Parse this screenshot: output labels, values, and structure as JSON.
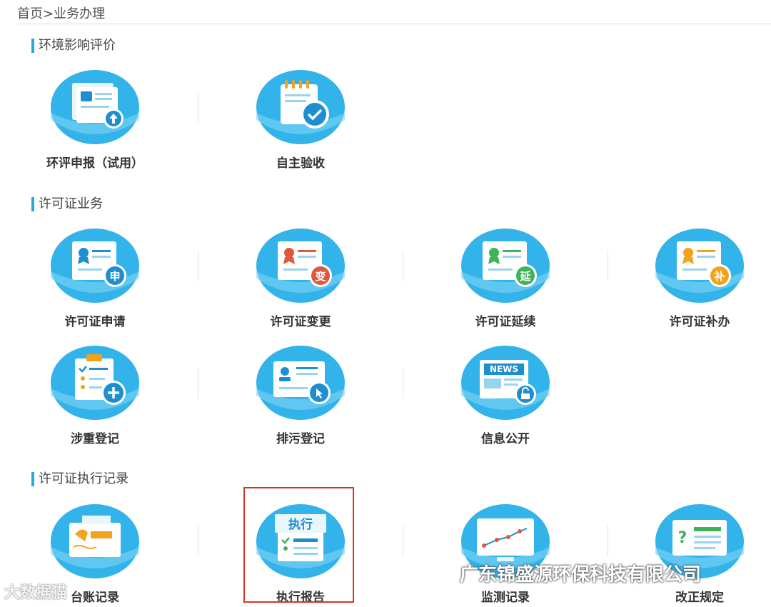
{
  "breadcrumb": "首页>业务办理",
  "sections": {
    "eia": "环境影响评价",
    "permit": "许可证业务",
    "records": "许可证执行记录"
  },
  "tiles": {
    "eia_report": "环评申报（试用）",
    "self_acceptance": "自主验收",
    "permit_apply": "许可证申请",
    "permit_change": "许可证变更",
    "permit_extend": "许可证延续",
    "permit_supplement": "许可证补办",
    "heavy_register": "涉重登记",
    "pollution_register": "排污登记",
    "info_disclosure": "信息公开",
    "ledger_record": "台账记录",
    "exec_report": "执行报告",
    "monitor_record": "监测记录",
    "rectify_rule": "改正规定"
  },
  "badges": {
    "apply": "申",
    "change": "变",
    "extend": "延",
    "supplement": "补",
    "news": "NEWS",
    "exec": "执行"
  },
  "watermark": {
    "left": "大数据猫",
    "right": "广东锦盛源环保科技有限公司"
  },
  "colors": {
    "accent": "#2aa5db",
    "highlight_border": "#d9342b",
    "badge_blue": "#1d8fd0",
    "badge_red": "#e0583b",
    "badge_green": "#3fb35a",
    "badge_orange": "#f2a31c"
  }
}
